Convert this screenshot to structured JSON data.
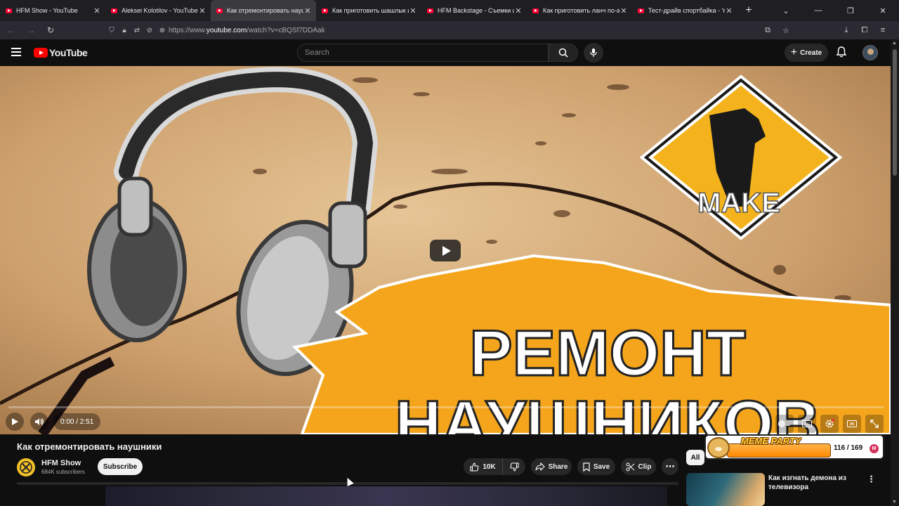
{
  "browser": {
    "tabs": [
      {
        "title": "HFM Show - YouTube",
        "active": false
      },
      {
        "title": "Aleksei Kolotilov - YouTube",
        "active": false
      },
      {
        "title": "Как отремонтировать наушни",
        "active": true
      },
      {
        "title": "Как приготовить шашлык из к",
        "active": false
      },
      {
        "title": "HFM Backstage - Съемки шаш",
        "active": false
      },
      {
        "title": "Как приготовить ланч по-амер",
        "active": false
      },
      {
        "title": "Тест-драйв спортбайка - YouT",
        "active": false
      }
    ],
    "url_prefix": "https://www.",
    "url_domain": "youtube.com",
    "url_path": "/watch?v=cBQSf7DDAak"
  },
  "youtube": {
    "logo_text": "YouTube",
    "search_placeholder": "Search",
    "create_label": "Create"
  },
  "player": {
    "time": "0:00 / 2:51",
    "thumbnail_text_line1": "РЕМОНТ",
    "thumbnail_text_line2": "НАУШНИКОВ",
    "thumbnail_badge_text": "MAKE",
    "progress": 0
  },
  "video": {
    "title": "Как отремонтировать наушники",
    "channel_name": "HFM Show",
    "channel_subs": "684K subscribers",
    "subscribe_label": "Subscribe",
    "likes": "10K",
    "share_label": "Share",
    "save_label": "Save",
    "clip_label": "Clip"
  },
  "sidebar": {
    "chip_all": "All",
    "overlay_title": "MEME PARTY",
    "overlay_count": "116 / 169",
    "overlay_badge": "M",
    "rec_title": "Как изгнать демона из телевизора"
  },
  "colors": {
    "accent": "#ff0000",
    "background": "#0f0f0f",
    "thumbnail_star": "#f4a51c"
  }
}
